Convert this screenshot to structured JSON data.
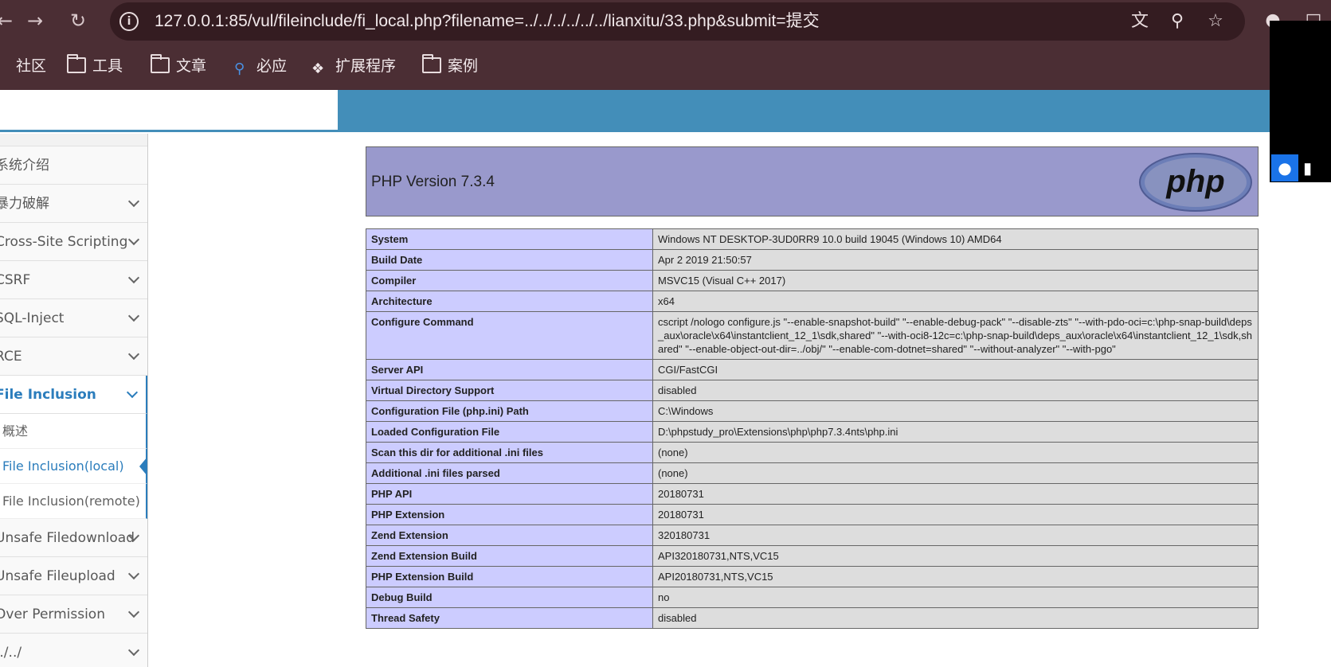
{
  "browser": {
    "url": "127.0.0.1:85/vul/fileinclude/fi_local.php?filename=../../../../../../lianxitu/33.php&submit=提交",
    "bookmarks": [
      {
        "label": "社区",
        "icon": "community-icon"
      },
      {
        "label": "工具",
        "icon": "folder-icon"
      },
      {
        "label": "文章",
        "icon": "folder-icon"
      },
      {
        "label": "必应",
        "icon": "search-icon"
      },
      {
        "label": "扩展程序",
        "icon": "puzzle-icon"
      },
      {
        "label": "案例",
        "icon": "folder-icon"
      }
    ]
  },
  "sidebar": {
    "items": [
      {
        "label": "系统介绍"
      },
      {
        "label": "暴力破解"
      },
      {
        "label": "Cross-Site Scripting"
      },
      {
        "label": "CSRF"
      },
      {
        "label": "SQL-Inject"
      },
      {
        "label": "RCE"
      },
      {
        "label": "File Inclusion"
      },
      {
        "label": "Unsafe Filedownload"
      },
      {
        "label": "Unsafe Fileupload"
      },
      {
        "label": "Over Permission"
      },
      {
        "label": "../../"
      }
    ],
    "subitems": [
      {
        "label": "概述"
      },
      {
        "label": "File Inclusion(local)"
      },
      {
        "label": "File Inclusion(remote)"
      }
    ]
  },
  "phpinfo": {
    "title": "PHP Version 7.3.4",
    "logo_text": "php",
    "rows": [
      {
        "k": "System",
        "v": "Windows NT DESKTOP-3UD0RR9 10.0 build 19045 (Windows 10) AMD64"
      },
      {
        "k": "Build Date",
        "v": "Apr 2 2019 21:50:57"
      },
      {
        "k": "Compiler",
        "v": "MSVC15 (Visual C++ 2017)"
      },
      {
        "k": "Architecture",
        "v": "x64"
      },
      {
        "k": "Configure Command",
        "v": "cscript /nologo configure.js \"--enable-snapshot-build\" \"--enable-debug-pack\" \"--disable-zts\" \"--with-pdo-oci=c:\\php-snap-build\\deps_aux\\oracle\\x64\\instantclient_12_1\\sdk,shared\" \"--with-oci8-12c=c:\\php-snap-build\\deps_aux\\oracle\\x64\\instantclient_12_1\\sdk,shared\" \"--enable-object-out-dir=../obj/\" \"--enable-com-dotnet=shared\" \"--without-analyzer\" \"--with-pgo\""
      },
      {
        "k": "Server API",
        "v": "CGI/FastCGI"
      },
      {
        "k": "Virtual Directory Support",
        "v": "disabled"
      },
      {
        "k": "Configuration File (php.ini) Path",
        "v": "C:\\Windows"
      },
      {
        "k": "Loaded Configuration File",
        "v": "D:\\phpstudy_pro\\Extensions\\php\\php7.3.4nts\\php.ini"
      },
      {
        "k": "Scan this dir for additional .ini files",
        "v": "(none)"
      },
      {
        "k": "Additional .ini files parsed",
        "v": "(none)"
      },
      {
        "k": "PHP API",
        "v": "20180731"
      },
      {
        "k": "PHP Extension",
        "v": "20180731"
      },
      {
        "k": "Zend Extension",
        "v": "320180731"
      },
      {
        "k": "Zend Extension Build",
        "v": "API320180731,NTS,VC15"
      },
      {
        "k": "PHP Extension Build",
        "v": "API20180731,NTS,VC15"
      },
      {
        "k": "Debug Build",
        "v": "no"
      },
      {
        "k": "Thread Safety",
        "v": "disabled"
      }
    ]
  },
  "colors": {
    "chrome": "#4b2e34",
    "header_blue": "#438eb9",
    "php_header": "#9999cc",
    "php_key": "#ccccff",
    "php_value": "#dddddd"
  }
}
